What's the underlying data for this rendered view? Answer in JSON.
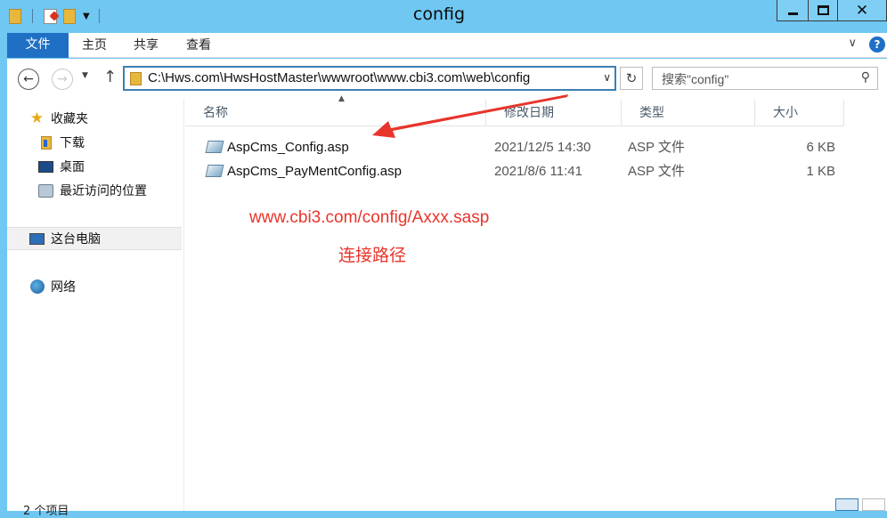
{
  "window": {
    "title": "config"
  },
  "ribbon": {
    "tabs": [
      "文件",
      "主页",
      "共享",
      "查看"
    ]
  },
  "address": {
    "path": "C:\\Hws.com\\HwsHostMaster\\wwwroot\\www.cbi3.com\\web\\config"
  },
  "search": {
    "placeholder": "搜索\"config\""
  },
  "nav": {
    "items": [
      {
        "label": "收藏夹",
        "icon": "star-icon"
      },
      {
        "label": "下载",
        "icon": "downloads-folder-icon"
      },
      {
        "label": "桌面",
        "icon": "desktop-icon"
      },
      {
        "label": "最近访问的位置",
        "icon": "recent-places-icon"
      },
      {
        "label": "这台电脑",
        "icon": "this-pc-icon"
      },
      {
        "label": "网络",
        "icon": "network-icon"
      }
    ]
  },
  "columns": [
    "名称",
    "修改日期",
    "类型",
    "大小"
  ],
  "files": [
    {
      "name": "AspCms_Config.asp",
      "date": "2021/12/5 14:30",
      "type": "ASP 文件",
      "size": "6 KB"
    },
    {
      "name": "AspCms_PayMentConfig.asp",
      "date": "2021/8/6 11:41",
      "type": "ASP 文件",
      "size": "1 KB"
    }
  ],
  "annotation": {
    "url": "www.cbi3.com/config/Axxx.sasp",
    "caption": "连接路径",
    "color": "#e8342b"
  },
  "status": {
    "count": "2 个项目"
  },
  "colors": {
    "titlebar": "#6fc7f2",
    "file_tab": "#1f6fc5"
  }
}
